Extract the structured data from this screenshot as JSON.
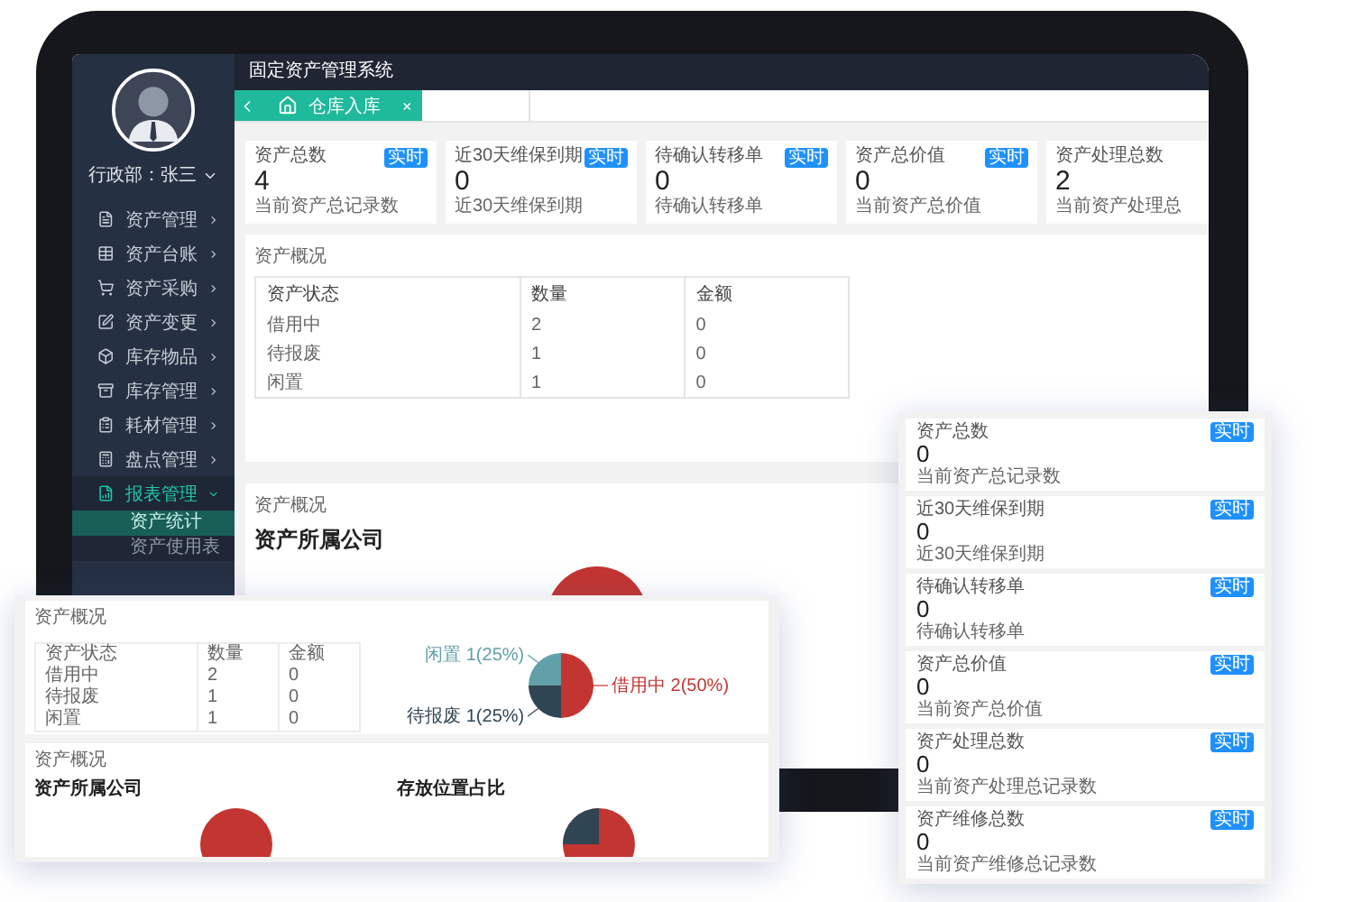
{
  "header": {
    "title": "固定资产管理系统"
  },
  "sidebar": {
    "user": "行政部：张三",
    "items": [
      {
        "label": "资产管理",
        "selected": false,
        "expanded": false
      },
      {
        "label": "资产台账",
        "selected": false,
        "expanded": false
      },
      {
        "label": "资产采购",
        "selected": false,
        "expanded": false
      },
      {
        "label": "资产变更",
        "selected": false,
        "expanded": false
      },
      {
        "label": "库存物品",
        "selected": false,
        "expanded": false
      },
      {
        "label": "库存管理",
        "selected": false,
        "expanded": false
      },
      {
        "label": "耗材管理",
        "selected": false,
        "expanded": false
      },
      {
        "label": "盘点管理",
        "selected": false,
        "expanded": false
      },
      {
        "label": "报表管理",
        "selected": true,
        "expanded": true,
        "children": [
          {
            "label": "资产统计",
            "selected": true
          },
          {
            "label": "资产使用表",
            "selected": false
          }
        ]
      }
    ]
  },
  "tabs": [
    {
      "label": "仓库入库",
      "selected": true,
      "close": "×"
    }
  ],
  "stat_cards": [
    {
      "title": "资产总数",
      "value": "4",
      "caption": "当前资产总记录数",
      "badge": "实时"
    },
    {
      "title": "近30天维保到期",
      "value": "0",
      "caption": "近30天维保到期",
      "badge": "实时"
    },
    {
      "title": "待确认转移单",
      "value": "0",
      "caption": "待确认转移单",
      "badge": "实时"
    },
    {
      "title": "资产总价值",
      "value": "0",
      "caption": "当前资产总价值",
      "badge": "实时"
    },
    {
      "title": "资产处理总数",
      "value": "2",
      "caption": "当前资产处理总"
    }
  ],
  "overview": {
    "title": "资产概况",
    "table": {
      "columns": [
        "资产状态",
        "数量",
        "金额"
      ],
      "rows": [
        [
          "借用中",
          "2",
          "0"
        ],
        [
          "待报废",
          "1",
          "0"
        ],
        [
          "闲置",
          "1",
          "0"
        ]
      ]
    }
  },
  "company_panel": {
    "title": "资产概况",
    "heading": "资产所属公司"
  },
  "overlay_report": {
    "overview": {
      "title": "资产概况",
      "table": {
        "columns": [
          "资产状态",
          "数量",
          "金额"
        ],
        "rows": [
          [
            "借用中",
            "2",
            "0"
          ],
          [
            "待报废",
            "1",
            "0"
          ],
          [
            "闲置",
            "1",
            "0"
          ]
        ]
      },
      "chart_data": {
        "type": "pie",
        "categories": [
          "借用中",
          "待报废",
          "闲置"
        ],
        "values": [
          2,
          1,
          1
        ],
        "data_labels": true,
        "value_labels": [
          "2(50%)",
          "1(25%)",
          "1(25%)"
        ]
      }
    },
    "distribution": {
      "title": "资产概况",
      "headings": [
        "资产所属公司",
        "存放位置占比"
      ]
    }
  },
  "overlay_cards": [
    {
      "title": "资产总数",
      "value": "0",
      "caption": "当前资产总记录数",
      "badge": "实时"
    },
    {
      "title": "近30天维保到期",
      "value": "0",
      "caption": "近30天维保到期",
      "badge": "实时"
    },
    {
      "title": "待确认转移单",
      "value": "0",
      "caption": "待确认转移单",
      "badge": "实时"
    },
    {
      "title": "资产总价值",
      "value": "0",
      "caption": "当前资产总价值",
      "badge": "实时"
    },
    {
      "title": "资产处理总数",
      "value": "0",
      "caption": "当前资产处理总记录数",
      "badge": "实时"
    },
    {
      "title": "资产维修总数",
      "value": "0",
      "caption": "当前资产维修总记录数",
      "badge": "实时"
    }
  ]
}
